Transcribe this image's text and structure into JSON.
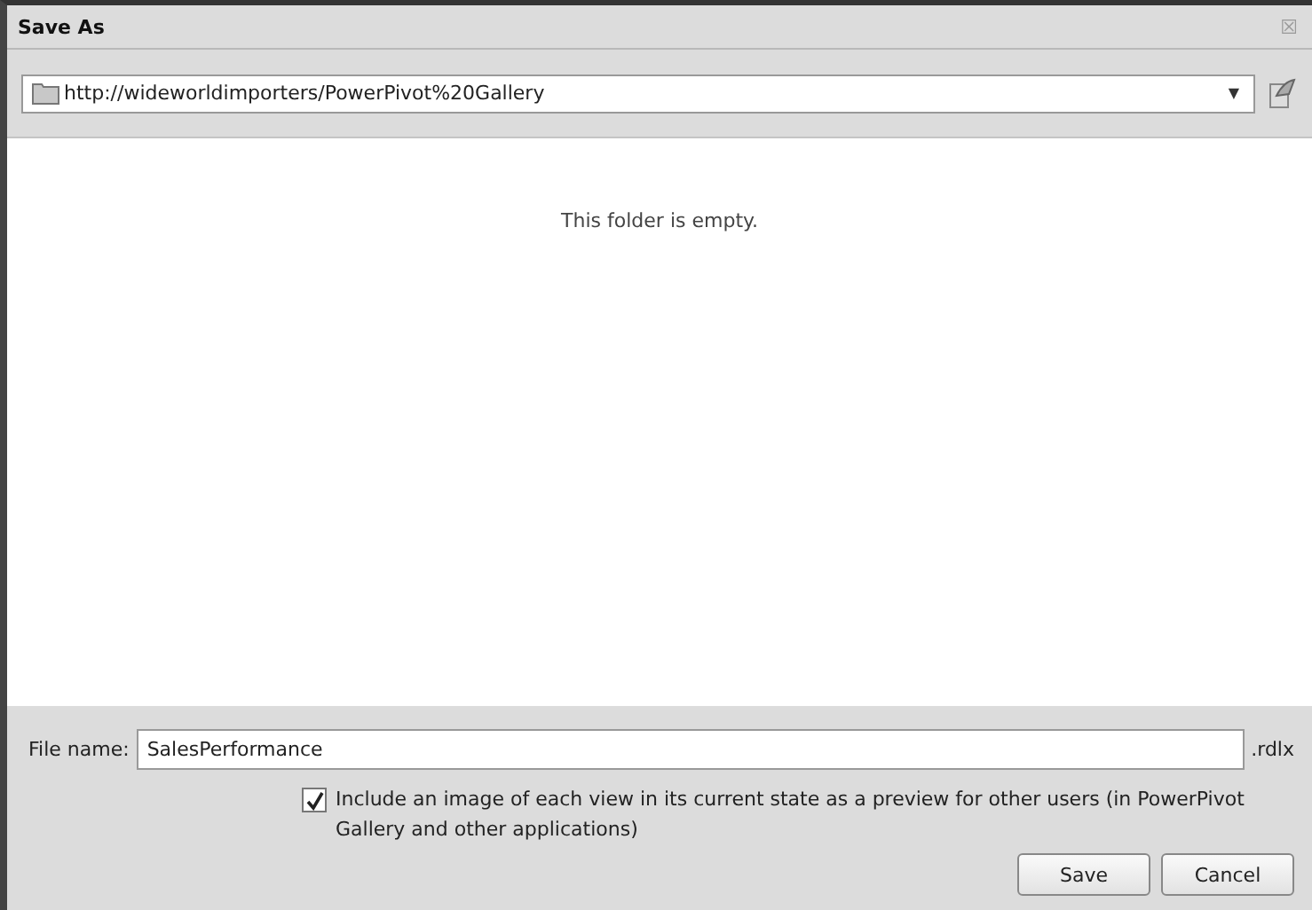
{
  "window": {
    "title": "Save As",
    "close": "☒"
  },
  "location": {
    "value": "http://wideworldimporters/PowerPivot%20Gallery",
    "dropdown": "▼"
  },
  "content": {
    "message": "This folder is empty."
  },
  "file_name": {
    "label": "File name:",
    "value": "SalesPerformance",
    "extension": ".rdlx"
  },
  "preview_option": {
    "label": "Include an image of each view in its current state as a preview for other users (in PowerPivot Gallery and other applications)",
    "checked": true
  },
  "buttons": [
    {
      "label": "Save"
    },
    {
      "label": "Cancel"
    }
  ]
}
